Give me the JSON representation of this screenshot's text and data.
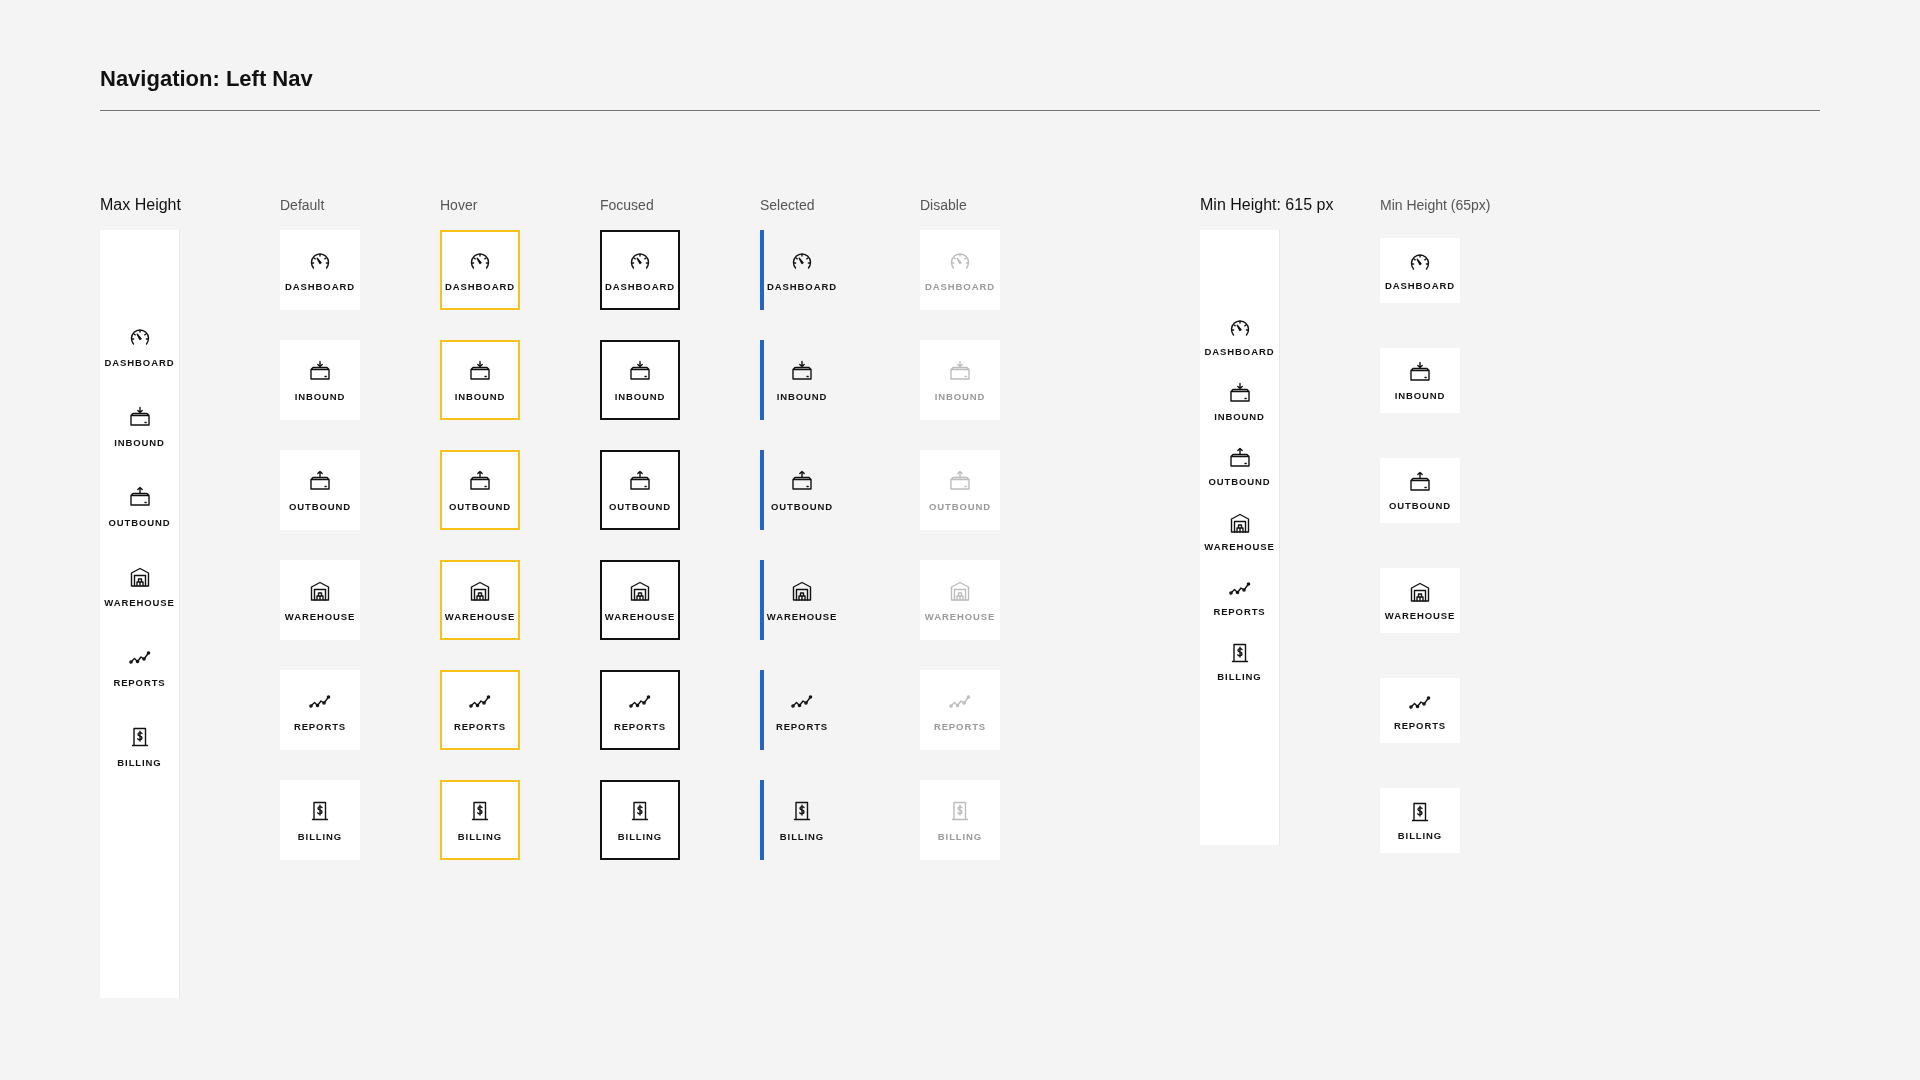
{
  "title": "Navigation: Left Nav",
  "max_height": {
    "heading": "Max Height",
    "items": [
      {
        "kind": "dashboard",
        "label": "DASHBOARD"
      },
      {
        "kind": "inbound",
        "label": "INBOUND"
      },
      {
        "kind": "outbound",
        "label": "OUTBOUND"
      },
      {
        "kind": "warehouse",
        "label": "WAREHOUSE"
      },
      {
        "kind": "reports",
        "label": "REPORTS"
      },
      {
        "kind": "billing",
        "label": "BILLING"
      }
    ]
  },
  "state_columns": [
    {
      "heading": "Default",
      "kind": "default",
      "items": [
        {
          "kind": "dashboard",
          "label": "DASHBOARD"
        },
        {
          "kind": "inbound",
          "label": "INBOUND"
        },
        {
          "kind": "outbound",
          "label": "OUTBOUND"
        },
        {
          "kind": "warehouse",
          "label": "WAREHOUSE"
        },
        {
          "kind": "reports",
          "label": "REPORTS"
        },
        {
          "kind": "billing",
          "label": "BILLING"
        }
      ]
    },
    {
      "heading": "Hover",
      "kind": "hover",
      "items": [
        {
          "kind": "dashboard",
          "label": "DASHBOARD"
        },
        {
          "kind": "inbound",
          "label": "INBOUND"
        },
        {
          "kind": "outbound",
          "label": "OUTBOUND"
        },
        {
          "kind": "warehouse",
          "label": "WAREHOUSE"
        },
        {
          "kind": "reports",
          "label": "REPORTS"
        },
        {
          "kind": "billing",
          "label": "BILLING"
        }
      ]
    },
    {
      "heading": "Focused",
      "kind": "focused",
      "items": [
        {
          "kind": "dashboard",
          "label": "DASHBOARD"
        },
        {
          "kind": "inbound",
          "label": "INBOUND"
        },
        {
          "kind": "outbound",
          "label": "OUTBOUND"
        },
        {
          "kind": "warehouse",
          "label": "WAREHOUSE"
        },
        {
          "kind": "reports",
          "label": "REPORTS"
        },
        {
          "kind": "billing",
          "label": "BILLING"
        }
      ]
    },
    {
      "heading": "Selected",
      "kind": "selected",
      "items": [
        {
          "kind": "dashboard",
          "label": "DASHBOARD"
        },
        {
          "kind": "inbound",
          "label": "INBOUND"
        },
        {
          "kind": "outbound",
          "label": "OUTBOUND"
        },
        {
          "kind": "warehouse",
          "label": "WAREHOUSE"
        },
        {
          "kind": "reports",
          "label": "REPORTS"
        },
        {
          "kind": "billing",
          "label": "BILLING"
        }
      ]
    },
    {
      "heading": "Disable",
      "kind": "disabled",
      "items": [
        {
          "kind": "dashboard",
          "label": "DASHBOARD"
        },
        {
          "kind": "inbound",
          "label": "INBOUND"
        },
        {
          "kind": "outbound",
          "label": "OUTBOUND"
        },
        {
          "kind": "warehouse",
          "label": "WAREHOUSE"
        },
        {
          "kind": "reports",
          "label": "REPORTS"
        },
        {
          "kind": "billing",
          "label": "BILLING"
        }
      ]
    }
  ],
  "min_height": {
    "heading": "Min Height: 615 px",
    "items": [
      {
        "kind": "dashboard",
        "label": "DASHBOARD"
      },
      {
        "kind": "inbound",
        "label": "INBOUND"
      },
      {
        "kind": "outbound",
        "label": "OUTBOUND"
      },
      {
        "kind": "warehouse",
        "label": "WAREHOUSE"
      },
      {
        "kind": "reports",
        "label": "REPORTS"
      },
      {
        "kind": "billing",
        "label": "BILLING"
      }
    ]
  },
  "min_height_65": {
    "heading": "Min Height (65px)",
    "items": [
      {
        "kind": "dashboard",
        "label": "DASHBOARD"
      },
      {
        "kind": "inbound",
        "label": "INBOUND"
      },
      {
        "kind": "outbound",
        "label": "OUTBOUND"
      },
      {
        "kind": "warehouse",
        "label": "WAREHOUSE"
      },
      {
        "kind": "reports",
        "label": "REPORTS"
      },
      {
        "kind": "billing",
        "label": "BILLING"
      }
    ]
  }
}
